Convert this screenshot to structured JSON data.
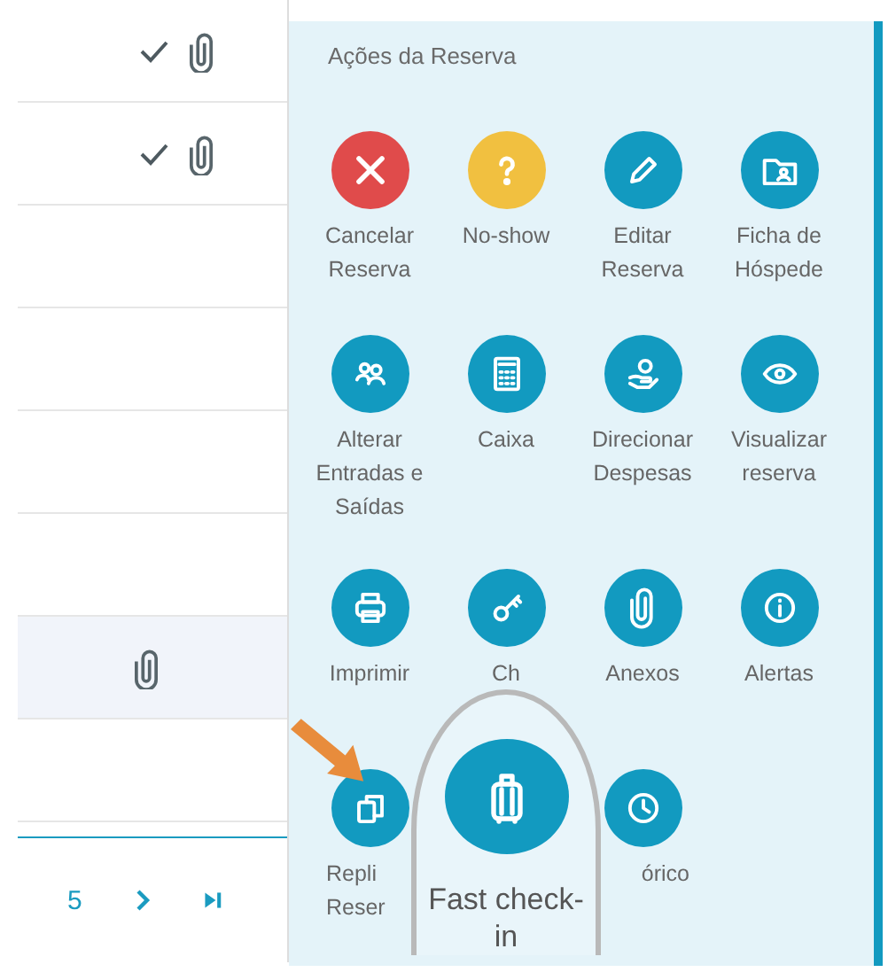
{
  "reservations": {
    "rows": [
      {
        "confirmed": true,
        "attachment": true,
        "selected": false
      },
      {
        "confirmed": true,
        "attachment": true,
        "selected": false
      },
      {
        "confirmed": false,
        "attachment": false,
        "selected": false
      },
      {
        "confirmed": false,
        "attachment": false,
        "selected": false
      },
      {
        "confirmed": false,
        "attachment": false,
        "selected": false
      },
      {
        "confirmed": false,
        "attachment": false,
        "selected": false
      },
      {
        "confirmed": false,
        "attachment": true,
        "selected": true
      },
      {
        "confirmed": false,
        "attachment": false,
        "selected": false
      }
    ],
    "pagination": {
      "page": "5"
    }
  },
  "actions_panel": {
    "title": "Ações da Reserva",
    "actions": [
      {
        "label": "Cancelar Reserva",
        "kind": "cancel",
        "color": "#e04b4b"
      },
      {
        "label": "No-show",
        "kind": "noshow",
        "color": "#f1c040"
      },
      {
        "label": "Editar Reserva",
        "kind": "edit",
        "color": "#129ac0"
      },
      {
        "label": "Ficha de Hóspede",
        "kind": "guest",
        "color": "#129ac0"
      },
      {
        "label": "Alterar Entradas e Saídas",
        "kind": "dates",
        "color": "#129ac0"
      },
      {
        "label": "Caixa",
        "kind": "cashier",
        "color": "#129ac0"
      },
      {
        "label": "Direcionar Despesas",
        "kind": "expenses",
        "color": "#129ac0"
      },
      {
        "label": "Visualizar reserva",
        "kind": "view",
        "color": "#129ac0"
      },
      {
        "label": "Imprimir",
        "kind": "print",
        "color": "#129ac0"
      },
      {
        "label": "Ch",
        "kind": "key",
        "color": "#129ac0"
      },
      {
        "label": "Anexos",
        "kind": "attachments",
        "color": "#129ac0"
      },
      {
        "label": "Alertas",
        "kind": "alerts",
        "color": "#129ac0"
      },
      {
        "label": "Repli\nReser",
        "kind": "replicate",
        "color": "#129ac0"
      },
      {
        "label": "Fast check-in",
        "kind": "checkin",
        "color": "#129ac0",
        "magnified": true
      },
      {
        "label": "órico",
        "kind": "history",
        "color": "#129ac0"
      }
    ]
  }
}
